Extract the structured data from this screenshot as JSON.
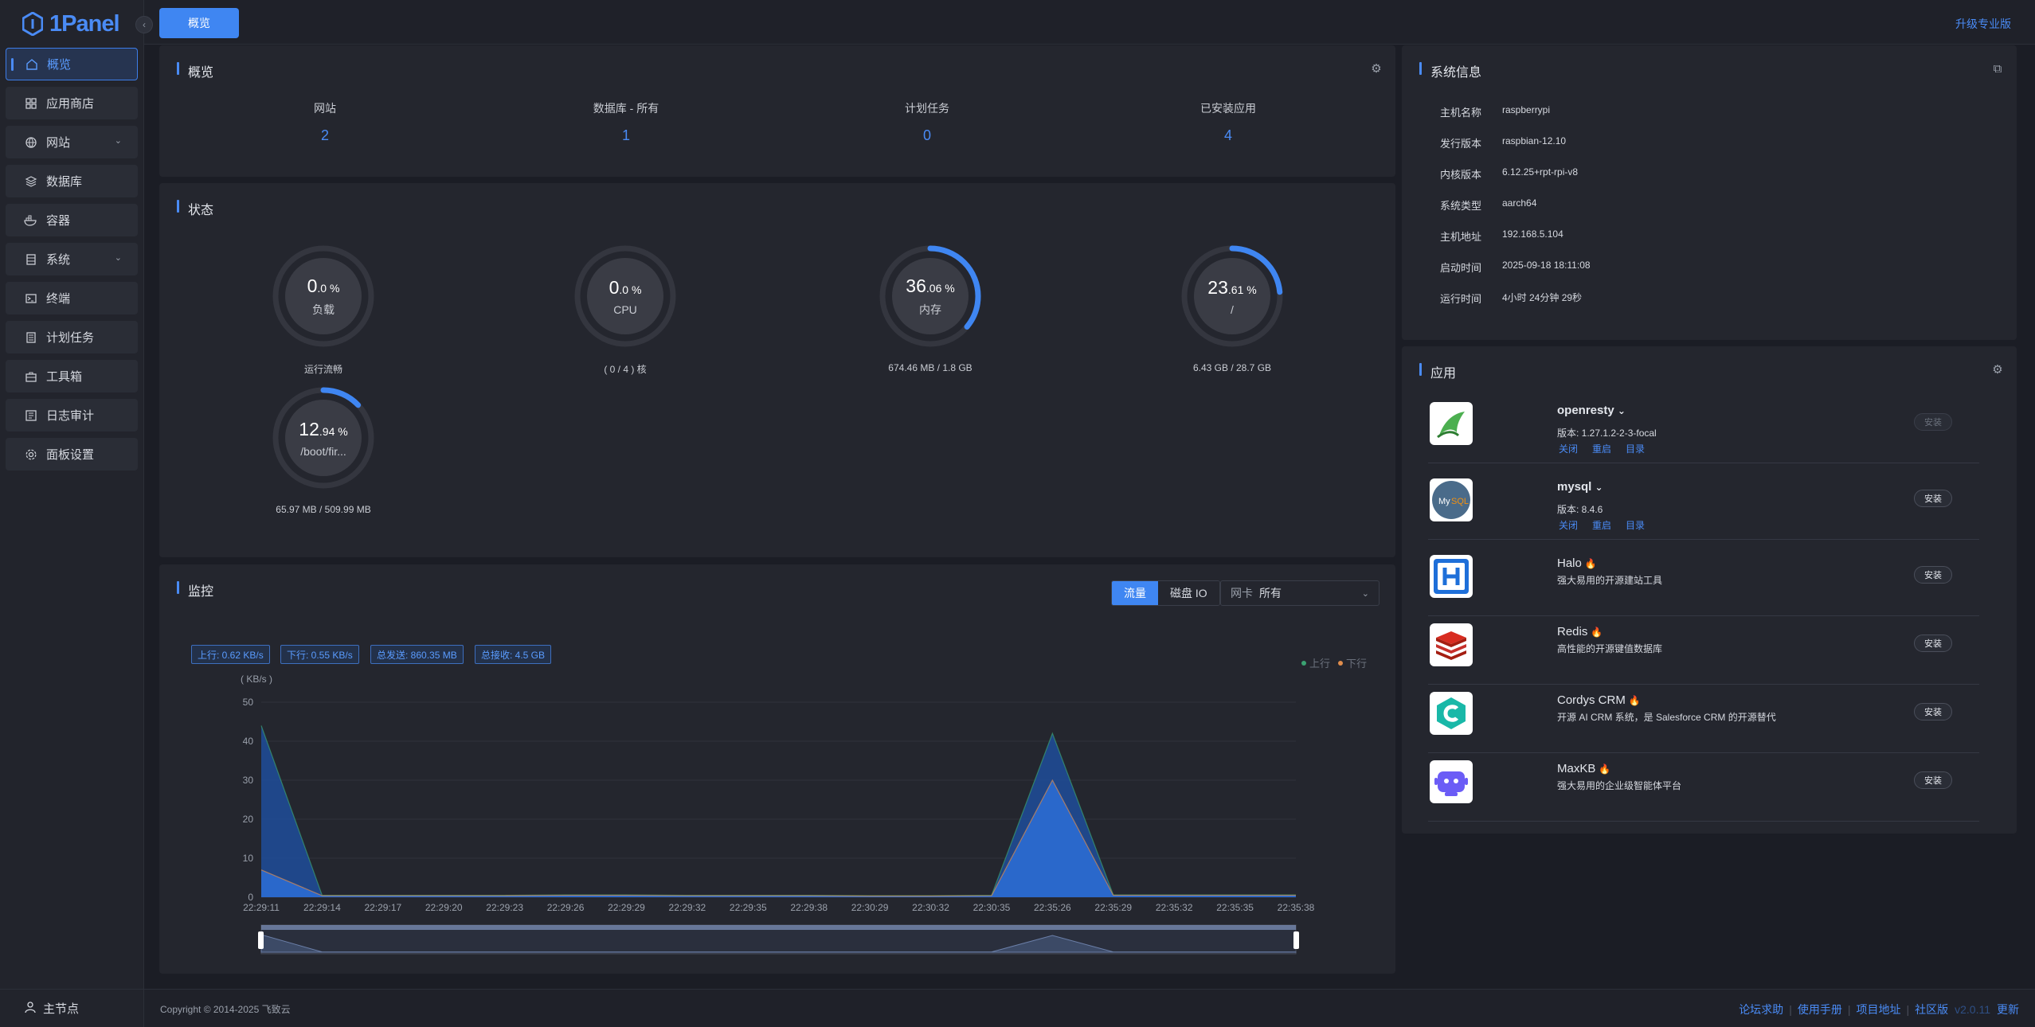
{
  "sidebar": {
    "logo_text": "1Panel",
    "items": [
      {
        "label": "概览",
        "icon": "home-icon",
        "active": true
      },
      {
        "label": "应用商店",
        "icon": "grid-icon"
      },
      {
        "label": "网站",
        "icon": "globe-icon",
        "expandable": true
      },
      {
        "label": "数据库",
        "icon": "layers-icon"
      },
      {
        "label": "容器",
        "icon": "docker-icon"
      },
      {
        "label": "系统",
        "icon": "server-icon",
        "expandable": true
      },
      {
        "label": "终端",
        "icon": "terminal-icon"
      },
      {
        "label": "计划任务",
        "icon": "list-icon"
      },
      {
        "label": "工具箱",
        "icon": "toolbox-icon"
      },
      {
        "label": "日志审计",
        "icon": "log-icon"
      },
      {
        "label": "面板设置",
        "icon": "gear-icon"
      }
    ],
    "node_label": "主节点"
  },
  "header": {
    "tab": "概览",
    "upgrade": "升级专业版"
  },
  "overview": {
    "title": "概览",
    "stats": [
      {
        "label": "网站",
        "value": "2"
      },
      {
        "label": "数据库 - 所有",
        "value": "1"
      },
      {
        "label": "计划任务",
        "value": "0"
      },
      {
        "label": "已安装应用",
        "value": "4"
      }
    ]
  },
  "status": {
    "title": "状态",
    "gauges": [
      {
        "int": "0",
        "dec": ".0 %",
        "name": "负载",
        "sub": "运行流畅",
        "percent": 0
      },
      {
        "int": "0",
        "dec": ".0 %",
        "name": "CPU",
        "sub": "( 0 / 4 ) 核",
        "percent": 0
      },
      {
        "int": "36",
        "dec": ".06 %",
        "name": "内存",
        "sub": "674.46 MB / 1.8 GB",
        "percent": 36.06
      },
      {
        "int": "23",
        "dec": ".61 %",
        "name": "/",
        "sub": "6.43 GB / 28.7 GB",
        "percent": 23.61
      },
      {
        "int": "12",
        "dec": ".94 %",
        "name": "/boot/fir...",
        "sub": "65.97 MB / 509.99 MB",
        "percent": 12.94
      }
    ]
  },
  "monitor": {
    "title": "监控",
    "tabs": [
      "流量",
      "磁盘 IO"
    ],
    "nic_label": "网卡",
    "nic_value": "所有",
    "tags": [
      "上行: 0.62 KB/s",
      "下行: 0.55 KB/s",
      "总发送: 860.35 MB",
      "总接收: 4.5 GB"
    ],
    "legend": [
      "上行",
      "下行"
    ],
    "colors": {
      "up": "#3ba272",
      "down": "#e08d4c",
      "fill": "#2d6fd6"
    }
  },
  "chart_data": {
    "type": "area",
    "ylabel": "( KB/s )",
    "ylim": [
      0,
      50
    ],
    "yticks": [
      "0",
      "10",
      "20",
      "30",
      "40",
      "50"
    ],
    "x": [
      "22:29:11",
      "22:29:14",
      "22:29:17",
      "22:29:20",
      "22:29:23",
      "22:29:26",
      "22:29:29",
      "22:29:32",
      "22:29:35",
      "22:29:38",
      "22:30:29",
      "22:30:32",
      "22:30:35",
      "22:35:26",
      "22:35:29",
      "22:35:32",
      "22:35:35",
      "22:35:38"
    ],
    "series": [
      {
        "name": "上行",
        "values": [
          44,
          0.5,
          0.5,
          0.5,
          0.5,
          0.6,
          0.6,
          0.5,
          0.5,
          0.5,
          0.4,
          0.4,
          0.5,
          42,
          0.6,
          0.6,
          0.6,
          0.6
        ]
      },
      {
        "name": "下行",
        "values": [
          7,
          0.4,
          0.4,
          0.4,
          0.4,
          0.5,
          0.5,
          0.4,
          0.4,
          0.4,
          0.3,
          0.3,
          0.4,
          30,
          0.5,
          0.5,
          0.5,
          0.5
        ]
      }
    ]
  },
  "system_info": {
    "title": "系统信息",
    "rows": [
      {
        "key": "主机名称",
        "value": "raspberrypi"
      },
      {
        "key": "发行版本",
        "value": "raspbian-12.10"
      },
      {
        "key": "内核版本",
        "value": "6.12.25+rpt-rpi-v8"
      },
      {
        "key": "系统类型",
        "value": "aarch64"
      },
      {
        "key": "主机地址",
        "value": "192.168.5.104"
      },
      {
        "key": "启动时间",
        "value": "2025-09-18 18:11:08"
      },
      {
        "key": "运行时间",
        "value": "4小时 24分钟 29秒"
      }
    ]
  },
  "apps": {
    "title": "应用",
    "installed": [
      {
        "name": "openresty",
        "version": "版本: 1.27.1.2-2-3-focal",
        "links": [
          "关闭",
          "重启",
          "目录"
        ],
        "button": "安装",
        "disabled": true
      },
      {
        "name": "mysql",
        "version": "版本: 8.4.6",
        "links": [
          "关闭",
          "重启",
          "目录"
        ],
        "button": "安装",
        "disabled": false
      }
    ],
    "recommended": [
      {
        "name": "Halo",
        "desc": "强大易用的开源建站工具",
        "button": "安装"
      },
      {
        "name": "Redis",
        "desc": "高性能的开源键值数据库",
        "button": "安装"
      },
      {
        "name": "Cordys CRM",
        "desc": "开源 AI CRM 系统，是 Salesforce CRM 的开源替代",
        "button": "安装"
      },
      {
        "name": "MaxKB",
        "desc": "强大易用的企业级智能体平台",
        "button": "安装"
      }
    ]
  },
  "footer": {
    "copyright": "Copyright © 2014-2025 飞致云",
    "links": [
      "论坛求助",
      "使用手册",
      "项目地址",
      "社区版"
    ],
    "version": "v2.0.11",
    "update": "更新"
  }
}
